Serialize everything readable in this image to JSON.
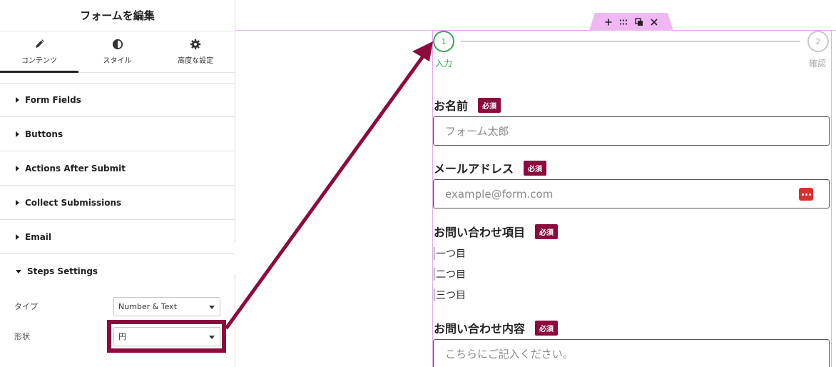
{
  "panel": {
    "title": "フォームを編集",
    "tabs": [
      {
        "label": "コンテンツ",
        "icon": "pencil-icon",
        "active": true
      },
      {
        "label": "スタイル",
        "icon": "half-circle-icon",
        "active": false
      },
      {
        "label": "高度な設定",
        "icon": "gear-icon",
        "active": false
      }
    ],
    "sections": [
      {
        "label": "Form Fields"
      },
      {
        "label": "Buttons"
      },
      {
        "label": "Actions After Submit"
      },
      {
        "label": "Collect Submissions"
      },
      {
        "label": "Email"
      },
      {
        "label": "Steps Settings"
      }
    ],
    "steps_settings": {
      "type_label": "タイプ",
      "type_value": "Number & Text",
      "shape_label": "形状",
      "shape_value": "円"
    }
  },
  "colors": {
    "accent": "#8c0a3d",
    "step_active": "#35a853",
    "step_inactive": "#aaaaaa",
    "widget_outline": "#e6a6f0"
  },
  "toolbar": {
    "icons": [
      "plus-icon",
      "drag-handle-icon",
      "duplicate-icon",
      "close-icon"
    ]
  },
  "steps": [
    {
      "number": "1",
      "label": "入力"
    },
    {
      "number": "2",
      "label": "確認"
    }
  ],
  "form": {
    "required_badge": "必須",
    "name": {
      "label": "お名前",
      "placeholder": "フォーム太郎"
    },
    "email": {
      "label": "メールアドレス",
      "placeholder": "example@form.com"
    },
    "inquiry": {
      "label": "お問い合わせ項目",
      "options": [
        "一つ目",
        "二つ目",
        "三つ目"
      ]
    },
    "message": {
      "label": "お問い合わせ内容",
      "placeholder": "こちらにご記入ください。"
    }
  }
}
